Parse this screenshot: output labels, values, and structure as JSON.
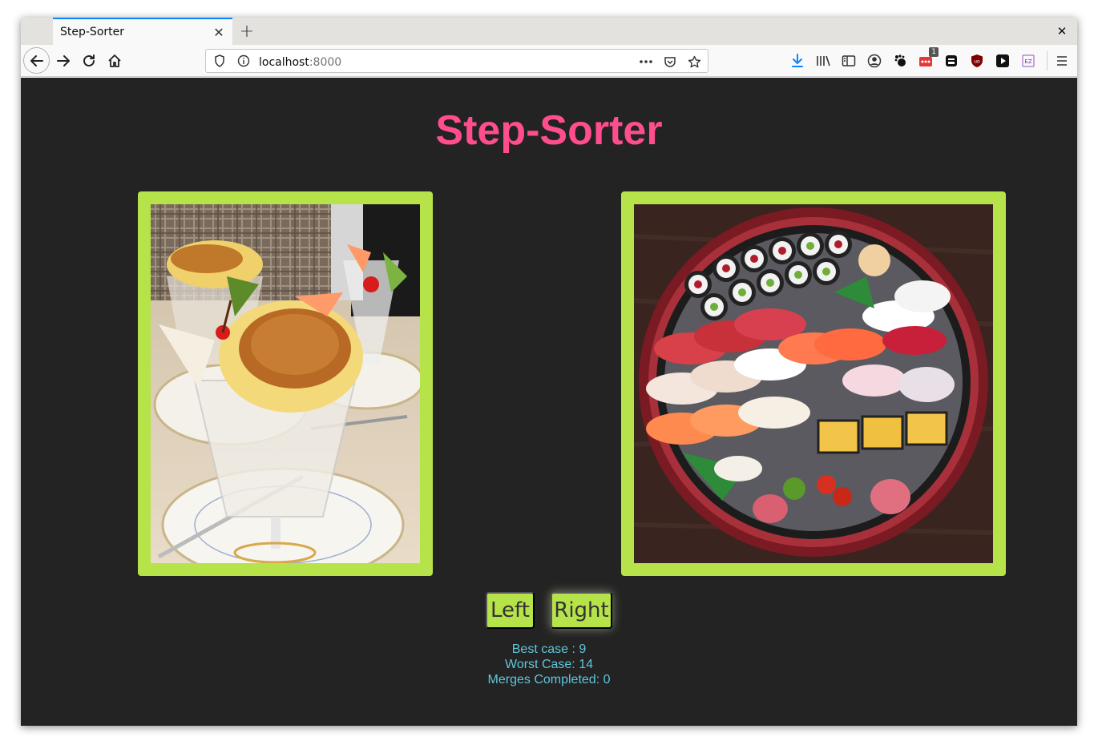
{
  "browser": {
    "tab_title": "Step-Sorter",
    "url_host": "localhost",
    "url_port": ":8000",
    "extension_badge": "1"
  },
  "page": {
    "title": "Step-Sorter",
    "left_button": "Left",
    "right_button": "Right",
    "stats": {
      "best_case": "Best case : 9",
      "worst_case": "Worst Case: 14",
      "merges": "Merges Completed: 0"
    }
  },
  "colors": {
    "background": "#232323",
    "title": "#ff4d8d",
    "frame": "#b7e34a",
    "stats": "#5ec7dc",
    "tab_accent": "#0a84ff"
  },
  "icons": [
    "back-arrow-icon",
    "forward-arrow-icon",
    "reload-icon",
    "home-icon",
    "shield-icon",
    "info-icon",
    "more-icon",
    "pocket-icon",
    "star-icon",
    "download-icon",
    "library-icon",
    "sidebar-icon",
    "account-icon",
    "extension-icon",
    "menu-icon"
  ]
}
